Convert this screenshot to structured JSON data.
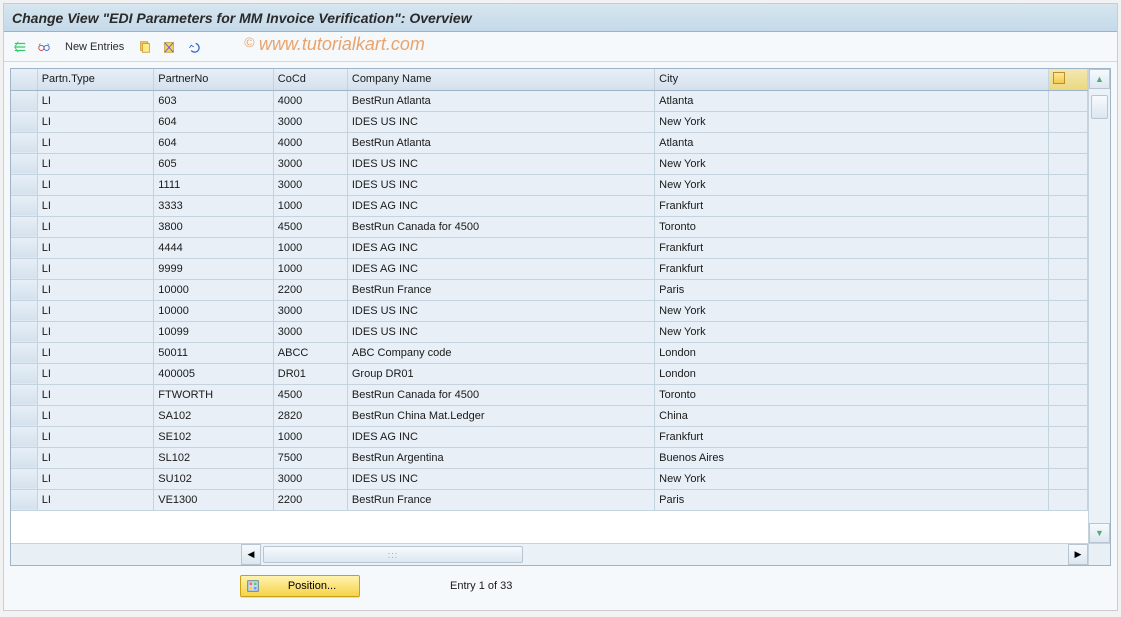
{
  "title": "Change View \"EDI Parameters for MM Invoice Verification\": Overview",
  "watermark": "www.tutorialkart.com",
  "watermark_copyright": "©",
  "toolbar": {
    "new_entries": "New Entries"
  },
  "table": {
    "headers": {
      "partn_type": "Partn.Type",
      "partner_no": "PartnerNo",
      "cocd": "CoCd",
      "company_name": "Company Name",
      "city": "City"
    },
    "rows": [
      {
        "pt": "LI",
        "pn": "603",
        "cc": "4000",
        "cn": "BestRun Atlanta",
        "ct": "Atlanta"
      },
      {
        "pt": "LI",
        "pn": "604",
        "cc": "3000",
        "cn": "IDES US INC",
        "ct": "New York"
      },
      {
        "pt": "LI",
        "pn": "604",
        "cc": "4000",
        "cn": "BestRun Atlanta",
        "ct": "Atlanta"
      },
      {
        "pt": "LI",
        "pn": "605",
        "cc": "3000",
        "cn": "IDES US INC",
        "ct": "New York"
      },
      {
        "pt": "LI",
        "pn": "1111",
        "cc": "3000",
        "cn": "IDES US INC",
        "ct": "New York"
      },
      {
        "pt": "LI",
        "pn": "3333",
        "cc": "1000",
        "cn": "IDES AG INC",
        "ct": "Frankfurt"
      },
      {
        "pt": "LI",
        "pn": "3800",
        "cc": "4500",
        "cn": "BestRun Canada for 4500",
        "ct": "Toronto"
      },
      {
        "pt": "LI",
        "pn": "4444",
        "cc": "1000",
        "cn": "IDES AG INC",
        "ct": "Frankfurt"
      },
      {
        "pt": "LI",
        "pn": "9999",
        "cc": "1000",
        "cn": "IDES AG INC",
        "ct": "Frankfurt"
      },
      {
        "pt": "LI",
        "pn": "10000",
        "cc": "2200",
        "cn": "BestRun France",
        "ct": "Paris"
      },
      {
        "pt": "LI",
        "pn": "10000",
        "cc": "3000",
        "cn": "IDES US INC",
        "ct": "New York"
      },
      {
        "pt": "LI",
        "pn": "10099",
        "cc": "3000",
        "cn": "IDES US INC",
        "ct": "New York"
      },
      {
        "pt": "LI",
        "pn": "50011",
        "cc": "ABCC",
        "cn": "ABC Company code",
        "ct": "London"
      },
      {
        "pt": "LI",
        "pn": "400005",
        "cc": "DR01",
        "cn": "Group DR01",
        "ct": "London"
      },
      {
        "pt": "LI",
        "pn": "FTWORTH",
        "cc": "4500",
        "cn": "BestRun Canada for 4500",
        "ct": "Toronto"
      },
      {
        "pt": "LI",
        "pn": "SA102",
        "cc": "2820",
        "cn": "BestRun China Mat.Ledger",
        "ct": "China"
      },
      {
        "pt": "LI",
        "pn": "SE102",
        "cc": "1000",
        "cn": "IDES AG INC",
        "ct": "Frankfurt"
      },
      {
        "pt": "LI",
        "pn": "SL102",
        "cc": "7500",
        "cn": "BestRun Argentina",
        "ct": "Buenos Aires"
      },
      {
        "pt": "LI",
        "pn": "SU102",
        "cc": "3000",
        "cn": "IDES US INC",
        "ct": "New York"
      },
      {
        "pt": "LI",
        "pn": "VE1300",
        "cc": "2200",
        "cn": "BestRun France",
        "ct": "Paris"
      }
    ]
  },
  "footer": {
    "position_label": "Position...",
    "entry_status": "Entry 1 of 33"
  }
}
